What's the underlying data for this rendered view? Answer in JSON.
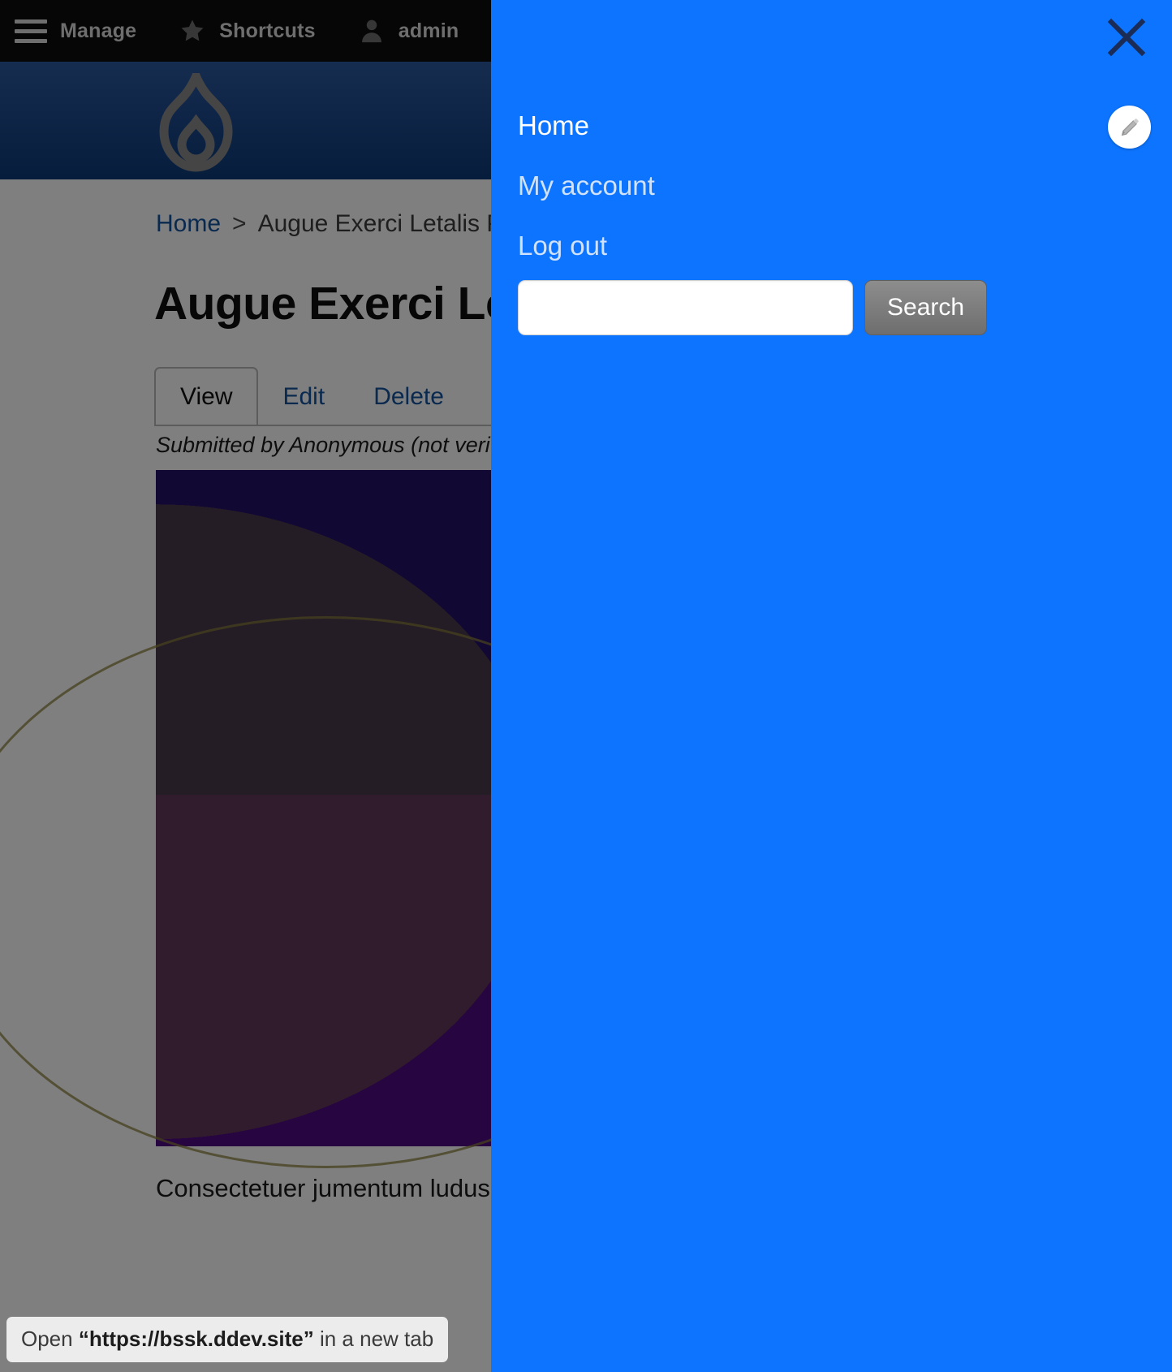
{
  "admin_toolbar": {
    "items": [
      {
        "label": "Manage",
        "icon": "hamburger-menu-icon"
      },
      {
        "label": "Shortcuts",
        "icon": "star-icon"
      },
      {
        "label": "admin",
        "icon": "user-account-icon"
      }
    ]
  },
  "site_header": {
    "logo": "drupal-droplet-logo"
  },
  "page": {
    "breadcrumb": {
      "home": "Home",
      "separator": ">",
      "current": "Augue Exerci Letalis P"
    },
    "title": "Augue Exerci Le",
    "tabs": [
      {
        "label": "View",
        "active": true
      },
      {
        "label": "Edit",
        "active": false
      },
      {
        "label": "Delete",
        "active": false
      }
    ],
    "submitted": "Submitted by Anonymous (not veri",
    "body": "Consectetuer jumentum ludus  ille neque pertineo quia. Acsi c genitus ill"
  },
  "overlay": {
    "background_color": "#0d74ff",
    "close_icon": "close-x-icon",
    "edit_icon": "pencil-edit-icon",
    "links": [
      {
        "label": "Home",
        "state": "current"
      },
      {
        "label": "My account",
        "state": "normal"
      },
      {
        "label": "Log out",
        "state": "normal"
      }
    ],
    "search": {
      "value": "",
      "placeholder": "",
      "button_label": "Search"
    }
  },
  "browser_status": {
    "prefix": "Open ",
    "url": "“https://bssk.ddev.site”",
    "suffix": " in a new tab"
  }
}
